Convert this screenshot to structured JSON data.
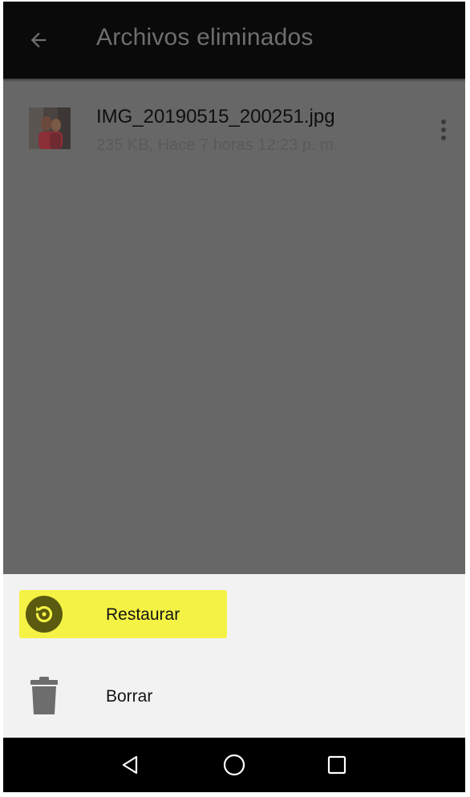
{
  "header": {
    "title": "Archivos eliminados",
    "back_icon": "arrow-left-icon"
  },
  "file": {
    "name": "IMG_20190515_200251.jpg",
    "meta": "235 KB, Hace 7 horas 12:23 p. m.",
    "thumbnail_icon": "image-thumbnail",
    "menu_icon": "more-vert-icon"
  },
  "sheet": {
    "items": [
      {
        "label": "Restaurar",
        "icon": "restore-icon",
        "highlighted": true
      },
      {
        "label": "Borrar",
        "icon": "trash-icon",
        "highlighted": false
      }
    ]
  },
  "navbar": {
    "buttons": [
      "back-triangle-icon",
      "home-circle-icon",
      "recents-square-icon"
    ]
  },
  "colors": {
    "appbar": "#0a0a0a",
    "scrim": "#676767",
    "highlight": "#f4f244",
    "sheet": "#f2f2f2",
    "restore_icon": "#5a5a10"
  }
}
